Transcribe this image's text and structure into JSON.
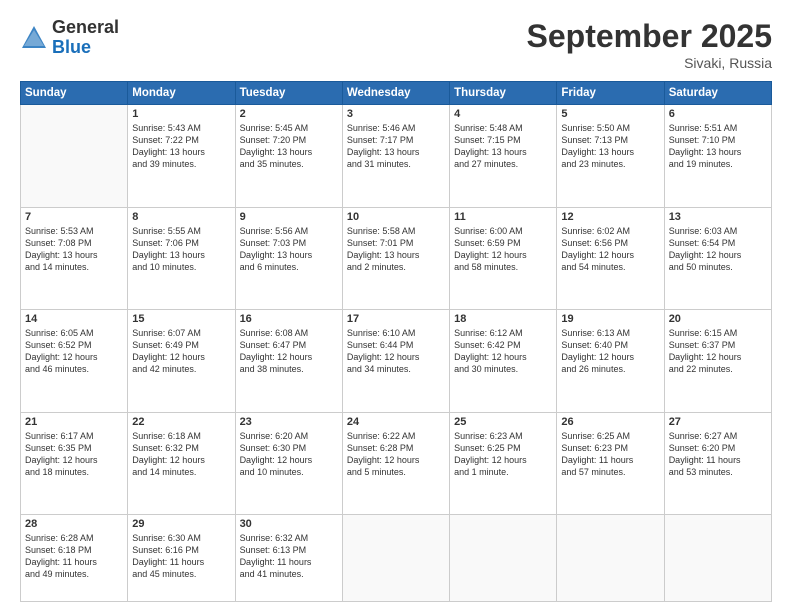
{
  "logo": {
    "general": "General",
    "blue": "Blue"
  },
  "title": "September 2025",
  "location": "Sivaki, Russia",
  "days_header": [
    "Sunday",
    "Monday",
    "Tuesday",
    "Wednesday",
    "Thursday",
    "Friday",
    "Saturday"
  ],
  "weeks": [
    [
      {
        "day": "",
        "text": ""
      },
      {
        "day": "1",
        "text": "Sunrise: 5:43 AM\nSunset: 7:22 PM\nDaylight: 13 hours\nand 39 minutes."
      },
      {
        "day": "2",
        "text": "Sunrise: 5:45 AM\nSunset: 7:20 PM\nDaylight: 13 hours\nand 35 minutes."
      },
      {
        "day": "3",
        "text": "Sunrise: 5:46 AM\nSunset: 7:17 PM\nDaylight: 13 hours\nand 31 minutes."
      },
      {
        "day": "4",
        "text": "Sunrise: 5:48 AM\nSunset: 7:15 PM\nDaylight: 13 hours\nand 27 minutes."
      },
      {
        "day": "5",
        "text": "Sunrise: 5:50 AM\nSunset: 7:13 PM\nDaylight: 13 hours\nand 23 minutes."
      },
      {
        "day": "6",
        "text": "Sunrise: 5:51 AM\nSunset: 7:10 PM\nDaylight: 13 hours\nand 19 minutes."
      }
    ],
    [
      {
        "day": "7",
        "text": "Sunrise: 5:53 AM\nSunset: 7:08 PM\nDaylight: 13 hours\nand 14 minutes."
      },
      {
        "day": "8",
        "text": "Sunrise: 5:55 AM\nSunset: 7:06 PM\nDaylight: 13 hours\nand 10 minutes."
      },
      {
        "day": "9",
        "text": "Sunrise: 5:56 AM\nSunset: 7:03 PM\nDaylight: 13 hours\nand 6 minutes."
      },
      {
        "day": "10",
        "text": "Sunrise: 5:58 AM\nSunset: 7:01 PM\nDaylight: 13 hours\nand 2 minutes."
      },
      {
        "day": "11",
        "text": "Sunrise: 6:00 AM\nSunset: 6:59 PM\nDaylight: 12 hours\nand 58 minutes."
      },
      {
        "day": "12",
        "text": "Sunrise: 6:02 AM\nSunset: 6:56 PM\nDaylight: 12 hours\nand 54 minutes."
      },
      {
        "day": "13",
        "text": "Sunrise: 6:03 AM\nSunset: 6:54 PM\nDaylight: 12 hours\nand 50 minutes."
      }
    ],
    [
      {
        "day": "14",
        "text": "Sunrise: 6:05 AM\nSunset: 6:52 PM\nDaylight: 12 hours\nand 46 minutes."
      },
      {
        "day": "15",
        "text": "Sunrise: 6:07 AM\nSunset: 6:49 PM\nDaylight: 12 hours\nand 42 minutes."
      },
      {
        "day": "16",
        "text": "Sunrise: 6:08 AM\nSunset: 6:47 PM\nDaylight: 12 hours\nand 38 minutes."
      },
      {
        "day": "17",
        "text": "Sunrise: 6:10 AM\nSunset: 6:44 PM\nDaylight: 12 hours\nand 34 minutes."
      },
      {
        "day": "18",
        "text": "Sunrise: 6:12 AM\nSunset: 6:42 PM\nDaylight: 12 hours\nand 30 minutes."
      },
      {
        "day": "19",
        "text": "Sunrise: 6:13 AM\nSunset: 6:40 PM\nDaylight: 12 hours\nand 26 minutes."
      },
      {
        "day": "20",
        "text": "Sunrise: 6:15 AM\nSunset: 6:37 PM\nDaylight: 12 hours\nand 22 minutes."
      }
    ],
    [
      {
        "day": "21",
        "text": "Sunrise: 6:17 AM\nSunset: 6:35 PM\nDaylight: 12 hours\nand 18 minutes."
      },
      {
        "day": "22",
        "text": "Sunrise: 6:18 AM\nSunset: 6:32 PM\nDaylight: 12 hours\nand 14 minutes."
      },
      {
        "day": "23",
        "text": "Sunrise: 6:20 AM\nSunset: 6:30 PM\nDaylight: 12 hours\nand 10 minutes."
      },
      {
        "day": "24",
        "text": "Sunrise: 6:22 AM\nSunset: 6:28 PM\nDaylight: 12 hours\nand 5 minutes."
      },
      {
        "day": "25",
        "text": "Sunrise: 6:23 AM\nSunset: 6:25 PM\nDaylight: 12 hours\nand 1 minute."
      },
      {
        "day": "26",
        "text": "Sunrise: 6:25 AM\nSunset: 6:23 PM\nDaylight: 11 hours\nand 57 minutes."
      },
      {
        "day": "27",
        "text": "Sunrise: 6:27 AM\nSunset: 6:20 PM\nDaylight: 11 hours\nand 53 minutes."
      }
    ],
    [
      {
        "day": "28",
        "text": "Sunrise: 6:28 AM\nSunset: 6:18 PM\nDaylight: 11 hours\nand 49 minutes."
      },
      {
        "day": "29",
        "text": "Sunrise: 6:30 AM\nSunset: 6:16 PM\nDaylight: 11 hours\nand 45 minutes."
      },
      {
        "day": "30",
        "text": "Sunrise: 6:32 AM\nSunset: 6:13 PM\nDaylight: 11 hours\nand 41 minutes."
      },
      {
        "day": "",
        "text": ""
      },
      {
        "day": "",
        "text": ""
      },
      {
        "day": "",
        "text": ""
      },
      {
        "day": "",
        "text": ""
      }
    ]
  ]
}
